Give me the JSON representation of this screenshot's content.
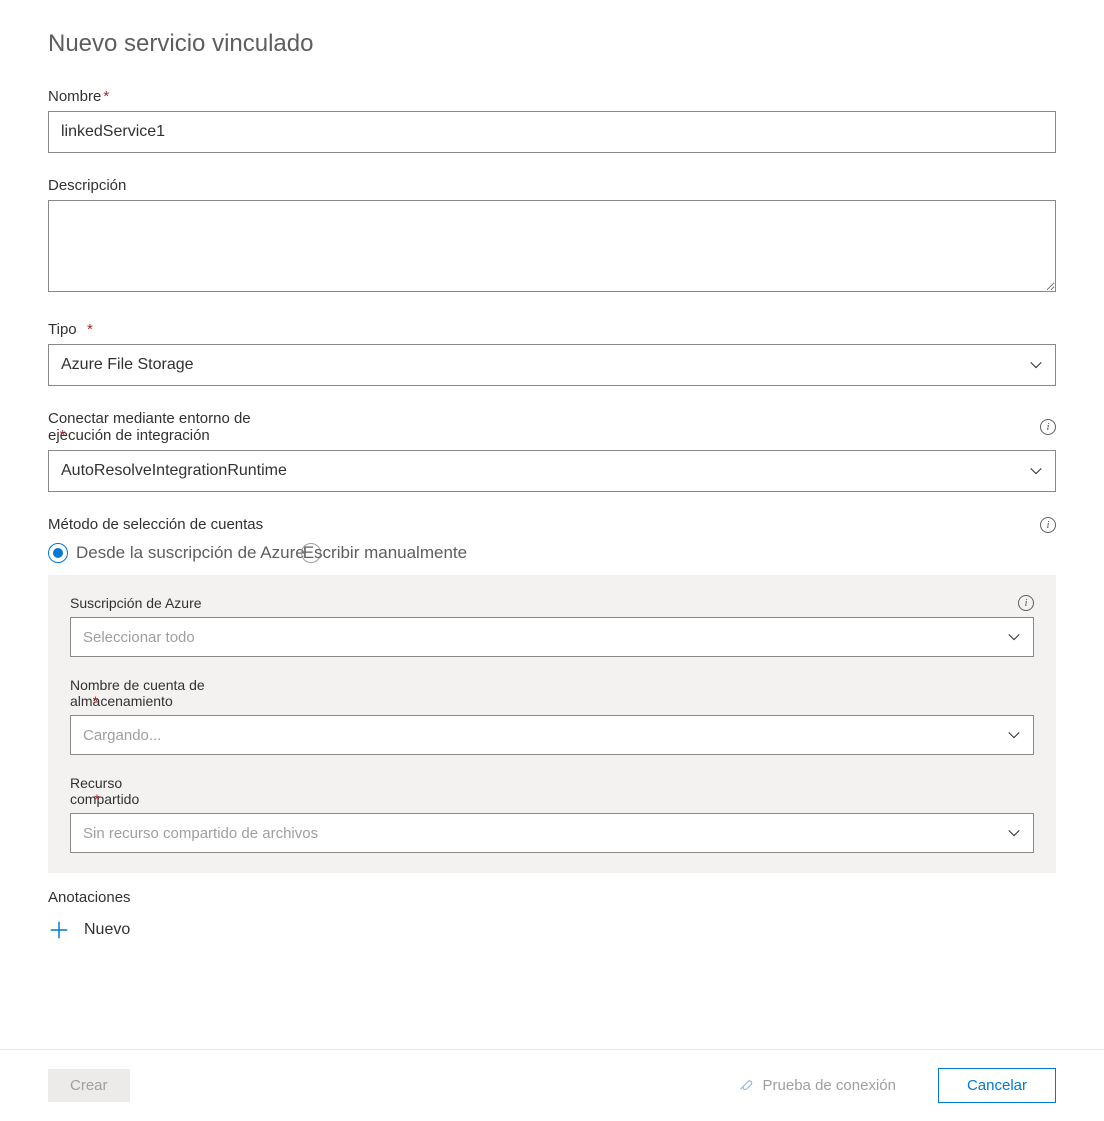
{
  "title": "Nuevo servicio vinculado",
  "fields": {
    "name": {
      "label": "Nombre",
      "value": "linkedService1"
    },
    "description": {
      "label": "Descripción",
      "value": ""
    },
    "type": {
      "label": "Tipo",
      "value": "Azure File Storage"
    },
    "ir": {
      "label": "Conectar mediante entorno de ejecución de integración",
      "value": "AutoResolveIntegrationRuntime"
    },
    "accountMethod": {
      "label": "Método de selección de cuentas",
      "options": {
        "fromSub": "Desde la suscripción de Azure",
        "manual": "Escribir manualmente"
      }
    },
    "subscription": {
      "label": "Suscripción de Azure",
      "placeholder": "Seleccionar todo"
    },
    "storageAccount": {
      "label": "Nombre de cuenta de almacenamiento",
      "placeholder": "Cargando..."
    },
    "fileShare": {
      "label": "Recurso compartido",
      "placeholder": "Sin recurso compartido de archivos"
    },
    "annotations": {
      "label": "Anotaciones",
      "addLabel": "Nuevo"
    }
  },
  "footer": {
    "create": "Crear",
    "testConnection": "Prueba de conexión",
    "cancel": "Cancelar"
  }
}
